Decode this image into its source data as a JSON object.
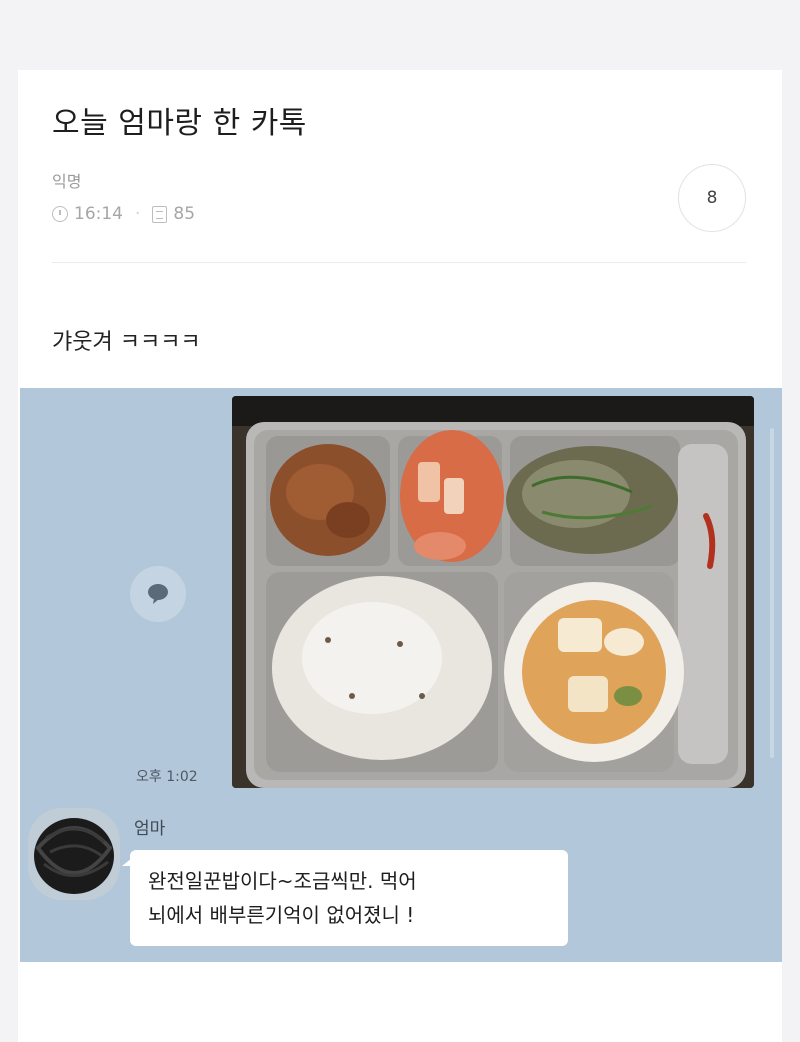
{
  "post": {
    "title": "오늘 엄마랑 한 카톡",
    "author": "익명",
    "time": "16:14",
    "views": "85",
    "comment_count": "8",
    "body": "갸웃겨 ㅋㅋㅋㅋ"
  },
  "chat": {
    "message_time": "오후 1:02",
    "sender_name": "엄마",
    "message_text": "완전일꾼밥이다~조금씩만. 먹어\n뇌에서 배부른기억이 없어졌니 !",
    "background_color": "#b2c7d9"
  },
  "icons": {
    "time": "clock-icon",
    "views": "document-icon",
    "share": "speech-bubble-icon"
  }
}
